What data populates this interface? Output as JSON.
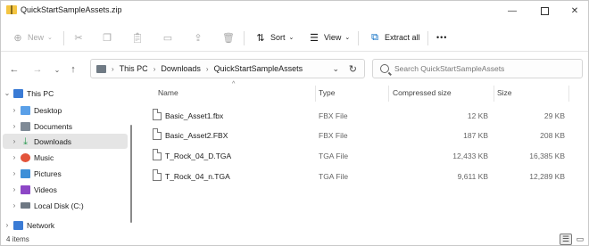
{
  "window": {
    "title": "QuickStartSampleAssets.zip",
    "controls": {
      "minimize": "—",
      "close": "✕"
    }
  },
  "commandbar": {
    "new_label": "New",
    "sort_label": "Sort",
    "view_label": "View",
    "extract_label": "Extract all",
    "more_label": "•••"
  },
  "address": {
    "crumbs": [
      "This PC",
      "Downloads",
      "QuickStartSampleAssets"
    ],
    "search_placeholder": "Search QuickStartSampleAssets"
  },
  "sidebar": {
    "items": [
      {
        "label": "This PC",
        "icon": "computer-icon",
        "color": "#3a7bd5"
      },
      {
        "label": "Desktop",
        "icon": "desktop-icon",
        "color": "#5aa0e8"
      },
      {
        "label": "Documents",
        "icon": "documents-icon",
        "color": "#7f8a96"
      },
      {
        "label": "Downloads",
        "icon": "download-icon",
        "color": "#2e9b54"
      },
      {
        "label": "Music",
        "icon": "music-icon",
        "color": "#e3543b"
      },
      {
        "label": "Pictures",
        "icon": "pictures-icon",
        "color": "#3d8fd8"
      },
      {
        "label": "Videos",
        "icon": "videos-icon",
        "color": "#8d47c6"
      },
      {
        "label": "Local Disk (C:)",
        "icon": "disk-icon",
        "color": "#6e7883"
      },
      {
        "label": "Network",
        "icon": "network-icon",
        "color": "#3a7bd5"
      }
    ]
  },
  "filelist": {
    "headers": {
      "name": "Name",
      "type": "Type",
      "compressed": "Compressed size",
      "size": "Size"
    },
    "rows": [
      {
        "name": "Basic_Asset1.fbx",
        "type": "FBX File",
        "compressed": "12 KB",
        "size": "29 KB"
      },
      {
        "name": "Basic_Asset2.FBX",
        "type": "FBX File",
        "compressed": "187 KB",
        "size": "208 KB"
      },
      {
        "name": "T_Rock_04_D.TGA",
        "type": "TGA File",
        "compressed": "12,433 KB",
        "size": "16,385 KB"
      },
      {
        "name": "T_Rock_04_n.TGA",
        "type": "TGA File",
        "compressed": "9,611 KB",
        "size": "12,289 KB"
      }
    ]
  },
  "status": {
    "items_text": "4 items"
  },
  "colors": {
    "accent": "#0067c0",
    "selected_bg": "#e5e5e5"
  }
}
